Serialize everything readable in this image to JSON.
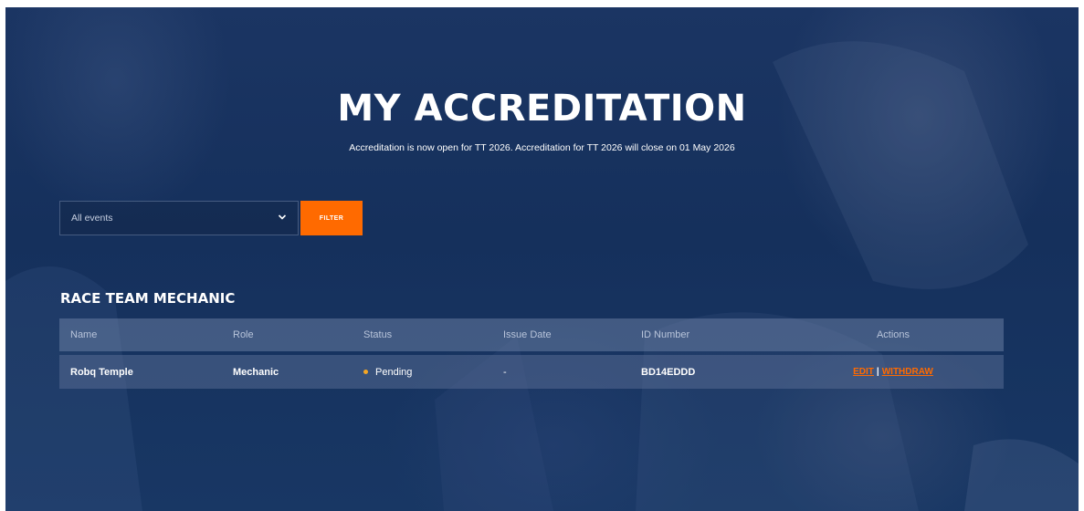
{
  "page": {
    "title": "MY ACCREDITATION",
    "subtitle": "Accreditation is now open for TT 2026. Accreditation for TT 2026 will close on 01 May 2026"
  },
  "filter": {
    "selected_event": "All events",
    "button_label": "FILTER"
  },
  "section": {
    "title": "RACE TEAM MECHANIC"
  },
  "table": {
    "headers": [
      "Name",
      "Role",
      "Status",
      "Issue Date",
      "ID Number",
      "Actions"
    ],
    "rows": [
      {
        "name": "Robq Temple",
        "role": "Mechanic",
        "status": "Pending",
        "issue_date": "-",
        "id_number": "BD14EDDD",
        "actions": {
          "edit": "EDIT",
          "separator": "|",
          "withdraw": "WITHDRAW"
        }
      }
    ]
  },
  "colors": {
    "accent": "#ff6a00",
    "background": "#15305c",
    "status_pending": "#f5a623"
  },
  "icons": {
    "select_arrow": "chevron-down-icon"
  }
}
